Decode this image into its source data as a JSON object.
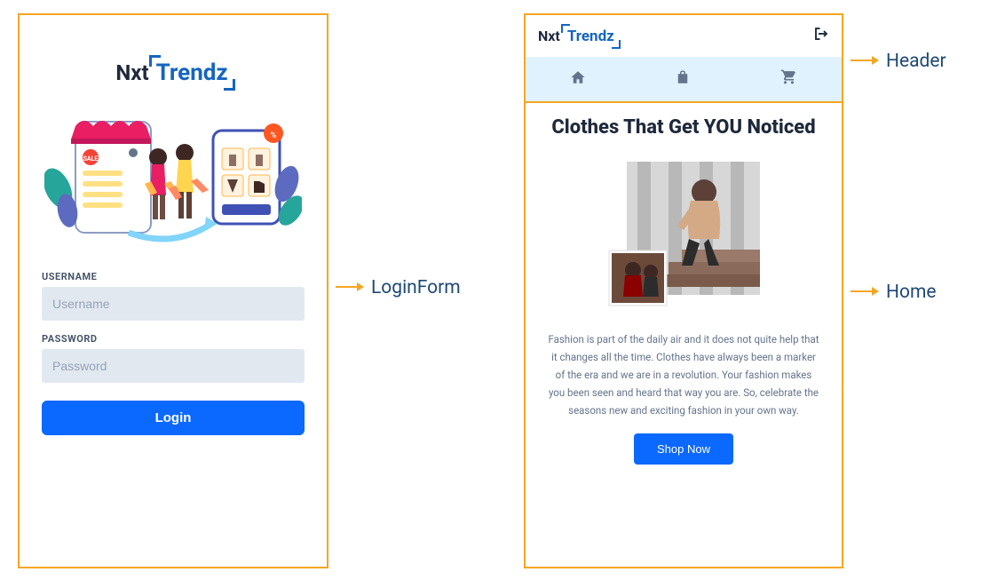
{
  "logo": {
    "part1": "Nxt",
    "part2": "Trendz"
  },
  "loginForm": {
    "usernameLabel": "USERNAME",
    "usernamePlaceholder": "Username",
    "passwordLabel": "PASSWORD",
    "passwordPlaceholder": "Password",
    "loginButton": "Login"
  },
  "header": {
    "icons": {
      "home": "home-icon",
      "products": "products-icon",
      "cart": "cart-icon",
      "logout": "logout-icon"
    }
  },
  "home": {
    "title": "Clothes That Get YOU Noticed",
    "description": "Fashion is part of the daily air and it does not quite help that it changes all the time. Clothes have always been a marker of the era and we are in a revolution. Your fashion makes you been seen and heard that way you are. So, celebrate the seasons new and exciting fashion in your own way.",
    "shopButton": "Shop Now"
  },
  "callouts": {
    "loginForm": "LoginForm",
    "header": "Header",
    "home": "Home"
  }
}
